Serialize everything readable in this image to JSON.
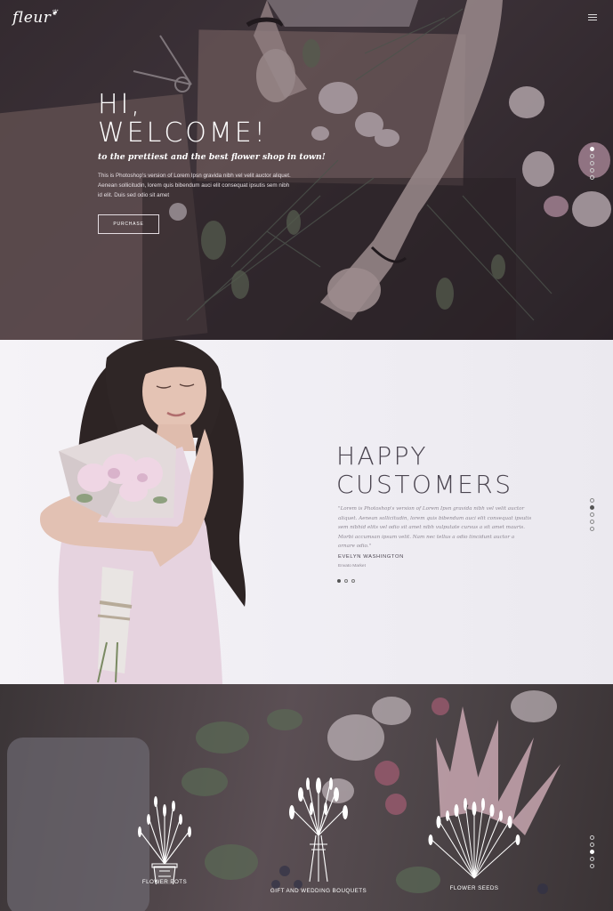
{
  "brand": {
    "logo": "fleur"
  },
  "hero": {
    "title_line1": "HI,",
    "title_line2": "WELCOME!",
    "tagline": "to the prettiest and the best flower shop in town!",
    "body": "This is Photoshop's version of Lorem Ipsn gravida nibh vel velit auctor aliquet. Aenean sollicitudin, lorem quis bibendum auci elit consequat ipsutis sem nibh id elit. Duis sed odio sit amet",
    "button_label": "PURCHASE"
  },
  "testimonial": {
    "title_line1": "HAPPY",
    "title_line2": "CUSTOMERS",
    "quote": "\"Lorem is Photoshop's version of Lorem Ipsn gravida nibh vel velit auctor aliquet. Aenean sollicitudin, lorem quis bibendum auci elit consequat ipsutis sem nibhid elits vel odio sit amet nibh vulputate cursus a sit amet mauris. Morbi accumsan ipsum velit. Nam nec tellus a odio tincidunt auctor a ornare odio.\"",
    "name": "EVELYN WASHINGTON",
    "role": "Envato Market"
  },
  "products": [
    {
      "label": "FLOWER POTS",
      "icon": "flower-pot-icon"
    },
    {
      "label": "GIFT AND WEDDING BOUQUETS",
      "icon": "bouquet-icon"
    },
    {
      "label": "FLOWER SEEDS",
      "icon": "flower-seeds-icon"
    }
  ],
  "colors": {
    "hero_overlay": "#3a3236",
    "heading_dark": "#4b4550",
    "muted_text": "#8d8792",
    "testimonial_bg": "#f1eff4"
  }
}
